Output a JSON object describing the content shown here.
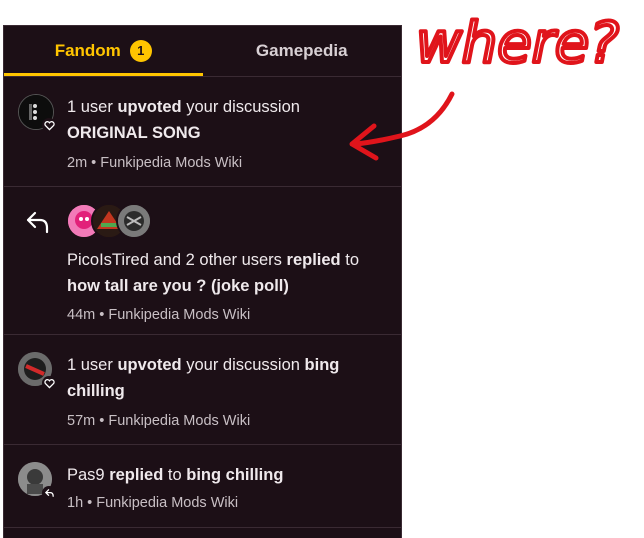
{
  "tabs": [
    {
      "label": "Fandom",
      "badge": "1"
    },
    {
      "label": "Gamepedia"
    }
  ],
  "notifications": [
    {
      "count_text": "1 user",
      "verb": "upvoted",
      "middle": "your discussion",
      "target": "ORIGINAL SONG",
      "meta": "2m • Funkipedia Mods Wiki",
      "action_icon": "heart-icon"
    },
    {
      "actor": "PicoIsTired",
      "middle": "and 2 other users",
      "verb": "replied",
      "tail": "to",
      "target": "how tall are you ? (joke poll)",
      "meta": "44m • Funkipedia Mods Wiki",
      "action_icon": "reply-arrow-icon"
    },
    {
      "count_text": "1 user",
      "verb": "upvoted",
      "middle": "your discussion",
      "target": "bing chilling",
      "meta": "57m • Funkipedia Mods Wiki",
      "action_icon": "heart-icon"
    },
    {
      "actor": "Pas9",
      "verb": "replied",
      "tail": "to",
      "target": "bing chilling",
      "meta": "1h • Funkipedia Mods Wiki",
      "action_icon": "reply-arrow-icon"
    }
  ],
  "annotation": {
    "text": "where?",
    "color": "#e0141b"
  },
  "colors": {
    "panel_bg": "#1c0f16",
    "accent": "#ffc500",
    "divider": "#3a2a33"
  }
}
